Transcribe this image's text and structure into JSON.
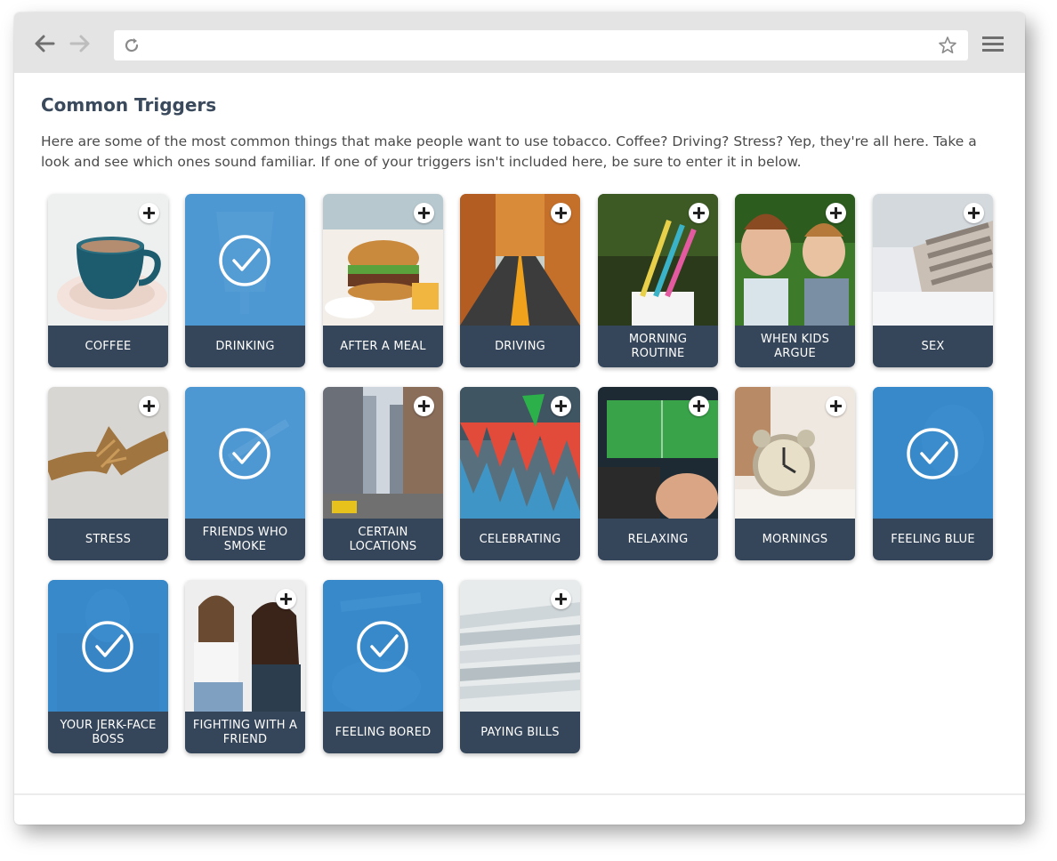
{
  "page": {
    "title": "Common Triggers",
    "intro": "Here are some of the most common things that make people want to use tobacco. Coffee? Driving? Stress? Yep, they're all here. Take a look and see which ones sound familiar. If one of your triggers isn't included here, be sure to enter it in below."
  },
  "browser": {
    "icons": [
      "arrow-left-icon",
      "arrow-right-icon",
      "reload-icon",
      "star-icon",
      "hamburger-menu-icon"
    ]
  },
  "colors": {
    "label_bg": "#36465a",
    "selected_overlay": "#3b8fd0",
    "title": "#3a4a5c"
  },
  "triggers": [
    {
      "label": "COFFEE",
      "selected": false,
      "image": "coffee-cup"
    },
    {
      "label": "DRINKING",
      "selected": true,
      "image": "drink-glass"
    },
    {
      "label": "AFTER A MEAL",
      "selected": false,
      "image": "burger-meal"
    },
    {
      "label": "DRIVING",
      "selected": false,
      "image": "autumn-road"
    },
    {
      "label": "MORNING ROUTINE",
      "selected": false,
      "image": "toothbrushes"
    },
    {
      "label": "WHEN KIDS ARGUE",
      "selected": false,
      "image": "kids-arguing"
    },
    {
      "label": "SEX",
      "selected": false,
      "image": "bed-pillows"
    },
    {
      "label": "STRESS",
      "selected": false,
      "image": "fraying-rope"
    },
    {
      "label": "FRIENDS WHO SMOKE",
      "selected": true,
      "image": "cigarette-hand"
    },
    {
      "label": "CERTAIN LOCATIONS",
      "selected": false,
      "image": "city-street"
    },
    {
      "label": "CELEBRATING",
      "selected": false,
      "image": "party-bunting"
    },
    {
      "label": "RELAXING",
      "selected": false,
      "image": "video-game"
    },
    {
      "label": "MORNINGS",
      "selected": false,
      "image": "alarm-clock"
    },
    {
      "label": "FEELING BLUE",
      "selected": true,
      "image": "sad-person"
    },
    {
      "label": "YOUR JERK-FACE BOSS",
      "selected": true,
      "image": "boss"
    },
    {
      "label": "FIGHTING WITH A FRIEND",
      "selected": false,
      "image": "two-women-arguing"
    },
    {
      "label": "FEELING BORED",
      "selected": true,
      "image": "bored-person"
    },
    {
      "label": "PAYING BILLS",
      "selected": false,
      "image": "paper-stack"
    }
  ]
}
